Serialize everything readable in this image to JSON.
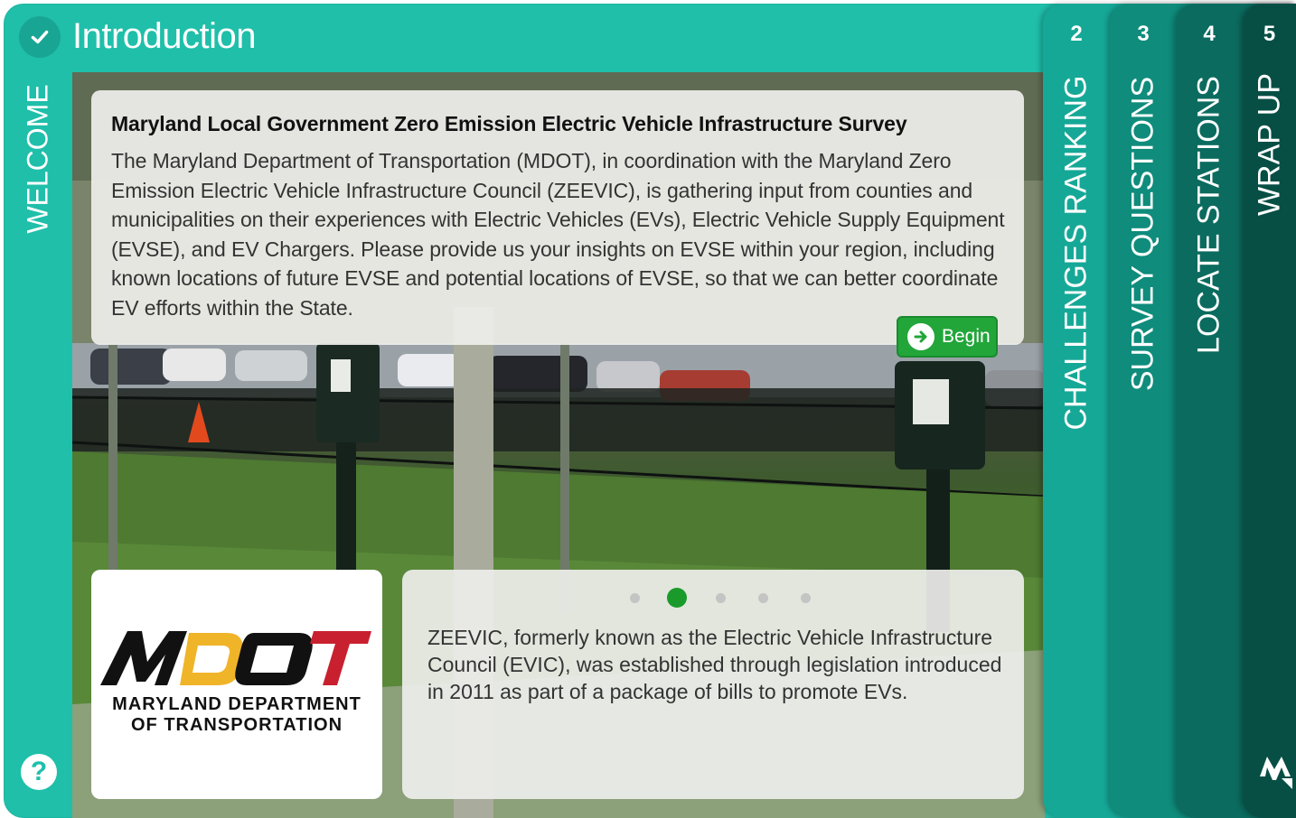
{
  "header": {
    "title": "Introduction",
    "welcome_label": "WELCOME",
    "check_icon": "check-icon",
    "help_label": "?"
  },
  "tabs": [
    {
      "number": "2",
      "label": "CHALLENGES RANKING"
    },
    {
      "number": "3",
      "label": "SURVEY QUESTIONS"
    },
    {
      "number": "4",
      "label": "LOCATE STATIONS"
    },
    {
      "number": "5",
      "label": "WRAP UP"
    }
  ],
  "intro": {
    "title": "Maryland Local Government Zero Emission Electric Vehicle Infrastructure Survey",
    "body": "The Maryland Department of Transportation (MDOT), in coordination with the Maryland Zero Emission Electric Vehicle Infrastructure Council (ZEEVIC), is gathering input from counties and municipalities on their experiences with Electric Vehicles (EVs), Electric Vehicle Supply Equipment (EVSE), and EV Chargers. Please provide us your insights on EVSE within your region, including known locations of future EVSE and potential locations of EVSE, so that we can better coordinate EV efforts within the State.",
    "begin_label": "Begin"
  },
  "logo": {
    "mark": "MDOT",
    "line1": "MARYLAND DEPARTMENT",
    "line2": "OF TRANSPORTATION"
  },
  "carousel": {
    "active_index": 1,
    "count": 5,
    "text": "ZEEVIC, formerly known as the Electric Vehicle Infrastructure Council (EVIC), was established through legislation introduced in 2011 as part of a package of bills to promote EVs."
  },
  "colors": {
    "teal": "#1fbfaa",
    "tab2": "#16a897",
    "tab3": "#0f8c7c",
    "tab4": "#0b6b5f",
    "tab5": "#074f45",
    "begin_green": "#22a63a"
  }
}
